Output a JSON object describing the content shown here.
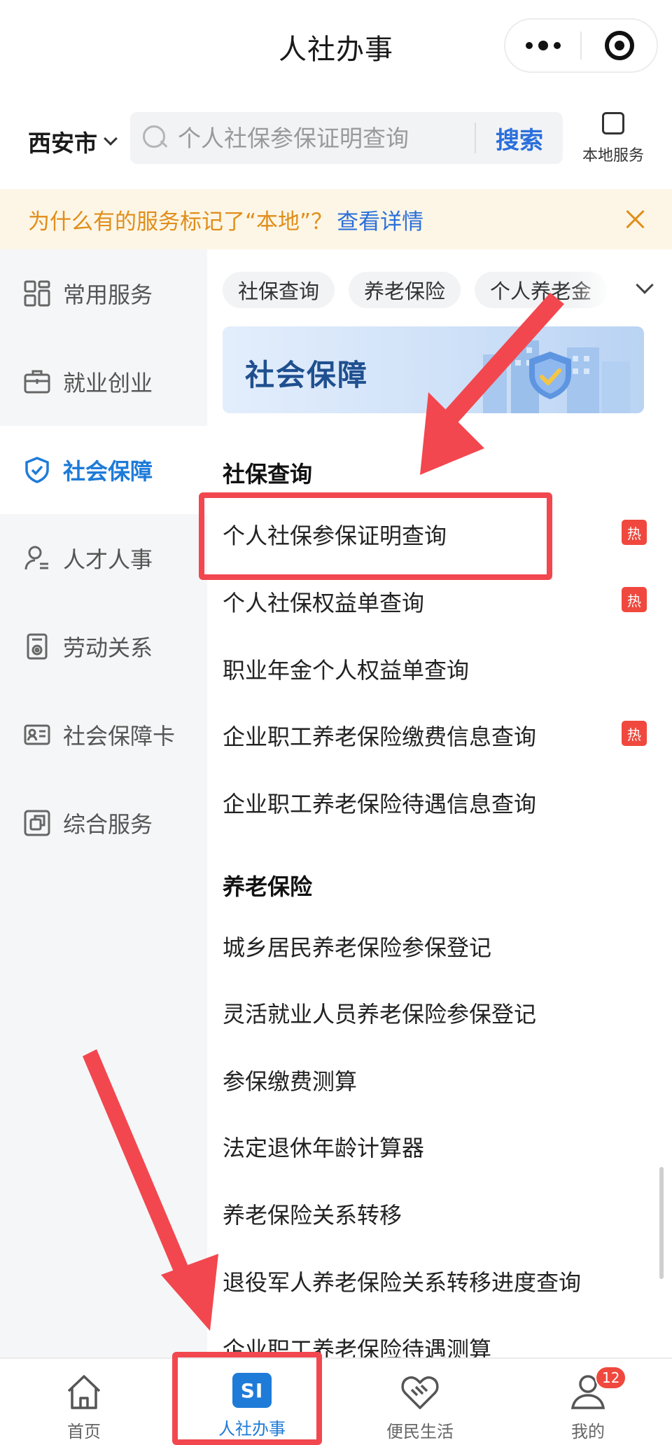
{
  "header": {
    "title": "人社办事"
  },
  "search": {
    "city": "西安市",
    "placeholder": "个人社保参保证明查询",
    "button_label": "搜索",
    "local_service_label": "本地服务"
  },
  "notice": {
    "text": "为什么有的服务标记了“本地”？",
    "link": "查看详情"
  },
  "sidebar": {
    "items": [
      {
        "label": "常用服务",
        "icon": "grid-icon",
        "active": false
      },
      {
        "label": "就业创业",
        "icon": "briefcase-icon",
        "active": false
      },
      {
        "label": "社会保障",
        "icon": "shield-check-icon",
        "active": true
      },
      {
        "label": "人才人事",
        "icon": "person-icon",
        "active": false
      },
      {
        "label": "劳动关系",
        "icon": "badge-icon",
        "active": false
      },
      {
        "label": "社会保障卡",
        "icon": "id-card-icon",
        "active": false
      },
      {
        "label": "综合服务",
        "icon": "layers-icon",
        "active": false
      }
    ]
  },
  "main": {
    "chips": [
      "社保查询",
      "养老保险",
      "个人养老金"
    ],
    "banner_title": "社会保障",
    "sections": [
      {
        "title": "社保查询",
        "items": [
          {
            "label": "个人社保参保证明查询",
            "hot": true
          },
          {
            "label": "个人社保权益单查询",
            "hot": true
          },
          {
            "label": "职业年金个人权益单查询",
            "hot": false
          },
          {
            "label": "企业职工养老保险缴费信息查询",
            "hot": true
          },
          {
            "label": "企业职工养老保险待遇信息查询",
            "hot": false
          }
        ]
      },
      {
        "title": "养老保险",
        "items": [
          {
            "label": "城乡居民养老保险参保登记",
            "hot": false
          },
          {
            "label": "灵活就业人员养老保险参保登记",
            "hot": false
          },
          {
            "label": "参保缴费测算",
            "hot": false
          },
          {
            "label": "法定退休年龄计算器",
            "hot": false
          },
          {
            "label": "养老保险关系转移",
            "hot": false
          },
          {
            "label": "退役军人养老保险关系转移进度查询",
            "hot": false
          },
          {
            "label": "企业职工养老保险待遇测算",
            "hot": false
          }
        ]
      }
    ],
    "hot_label": "热"
  },
  "tabbar": {
    "tabs": [
      {
        "label": "首页",
        "icon": "home-icon",
        "active": false
      },
      {
        "label": "人社办事",
        "icon": "si-icon",
        "active": true,
        "icon_text": "SI"
      },
      {
        "label": "便民生活",
        "icon": "handshake-heart-icon",
        "active": false
      },
      {
        "label": "我的",
        "icon": "user-icon",
        "active": false,
        "badge": "12"
      }
    ]
  },
  "colors": {
    "accent": "#1e7bd8",
    "hot": "#f0483e",
    "notice_bg": "#fdf6e6",
    "notice_text": "#e08e1a",
    "annotation": "#f2474f"
  }
}
